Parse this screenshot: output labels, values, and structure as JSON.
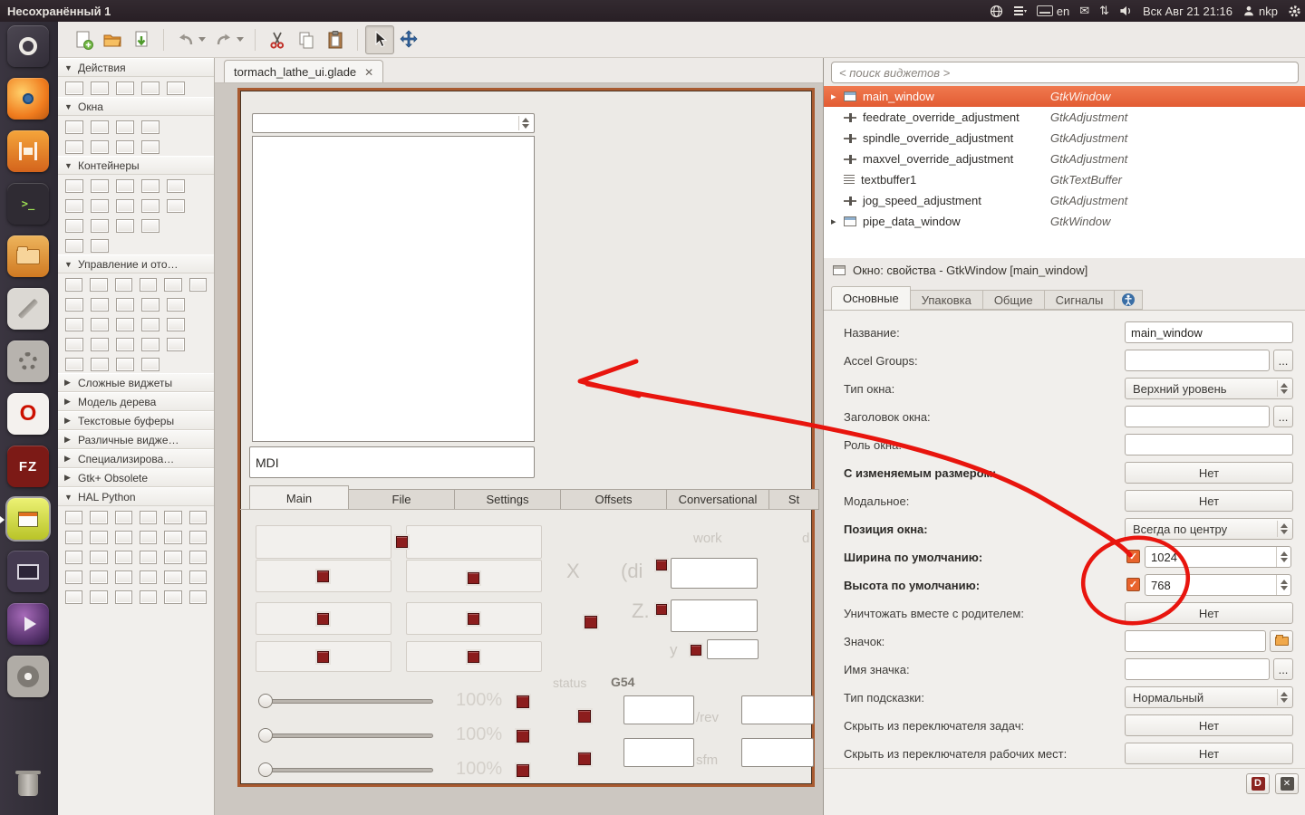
{
  "top_bar": {
    "title": "Несохранённый 1",
    "keyboard_layout": "en",
    "clock": "Вск Авг 21 21:16",
    "user": "nkp"
  },
  "dock": {
    "items": [
      "dash-home",
      "firefox",
      "software-center",
      "terminal",
      "file-manager",
      "text-editor",
      "system-settings",
      "opera",
      "filezilla",
      "glade",
      "remote-screen",
      "media-player",
      "disks",
      "trash"
    ]
  },
  "toolbar": {
    "icons": [
      "new-file",
      "open-file",
      "save-file",
      "undo",
      "undo-menu",
      "redo",
      "redo-menu",
      "cut",
      "copy",
      "paste",
      "selector",
      "drag-resize"
    ]
  },
  "palette": {
    "sections": [
      {
        "label": "Действия",
        "arrow": "▼",
        "rows": [
          5
        ]
      },
      {
        "label": "Окна",
        "arrow": "▼",
        "rows": [
          4,
          4
        ]
      },
      {
        "label": "Контейнеры",
        "arrow": "▼",
        "rows": [
          5,
          5,
          4,
          2
        ]
      },
      {
        "label": "Управление и ото…",
        "arrow": "▼",
        "rows": [
          6,
          5,
          5,
          5,
          4
        ]
      },
      {
        "label": "Сложные виджеты",
        "arrow": "▶",
        "rows": []
      },
      {
        "label": "Модель дерева",
        "arrow": "▶",
        "rows": []
      },
      {
        "label": "Текстовые буферы",
        "arrow": "▶",
        "rows": []
      },
      {
        "label": "Различные видже…",
        "arrow": "▶",
        "rows": []
      },
      {
        "label": "Специализирова…",
        "arrow": "▶",
        "rows": []
      },
      {
        "label": "Gtk+ Obsolete",
        "arrow": "▶",
        "rows": []
      },
      {
        "label": "HAL Python",
        "arrow": "▼",
        "rows": [
          6,
          6,
          6,
          6,
          6
        ]
      }
    ]
  },
  "editor": {
    "tab_label": "tormach_lathe_ui.glade"
  },
  "canvas": {
    "mdi_text": "MDI",
    "tabs": [
      "Main",
      "File",
      "Settings",
      "Offsets",
      "Conversational",
      "St"
    ],
    "labels": {
      "work": "work",
      "d": "d",
      "x": "X",
      "dia": "(di",
      "z": "Z.",
      "y": "y",
      "status": "status",
      "g54": "G54",
      "rev": "/rev",
      "sfm": "sfm"
    },
    "sliders": [
      "100%",
      "100%",
      "100%"
    ]
  },
  "tree": {
    "search_placeholder": "< поиск виджетов >",
    "rows": [
      {
        "name": "main_window",
        "cls": "GtkWindow"
      },
      {
        "name": "feedrate_override_adjustment",
        "cls": "GtkAdjustment"
      },
      {
        "name": "spindle_override_adjustment",
        "cls": "GtkAdjustment"
      },
      {
        "name": "maxvel_override_adjustment",
        "cls": "GtkAdjustment"
      },
      {
        "name": "textbuffer1",
        "cls": "GtkTextBuffer"
      },
      {
        "name": "jog_speed_adjustment",
        "cls": "GtkAdjustment"
      },
      {
        "name": "pipe_data_window",
        "cls": "GtkWindow"
      }
    ]
  },
  "properties": {
    "title": "Окно: свойства - GtkWindow [main_window]",
    "tabs": [
      "Основные",
      "Упаковка",
      "Общие",
      "Сигналы"
    ],
    "rows": [
      {
        "label": "Название:",
        "value": "main_window"
      },
      {
        "label": "Accel Groups:",
        "value": ""
      },
      {
        "label": "Тип окна:",
        "value": "Верхний уровень"
      },
      {
        "label": "Заголовок окна:",
        "value": ""
      },
      {
        "label": "Роль окна:",
        "value": ""
      },
      {
        "label": "С изменяемым размером:",
        "value": "Нет"
      },
      {
        "label": "Модальное:",
        "value": "Нет"
      },
      {
        "label": "Позиция окна:",
        "value": "Всегда по центру"
      },
      {
        "label": "Ширина по умолчанию:",
        "value": "1024"
      },
      {
        "label": "Высота по умолчанию:",
        "value": "768"
      },
      {
        "label": "Уничтожать вместе с родителем:",
        "value": "Нет"
      },
      {
        "label": "Значок:",
        "value": ""
      },
      {
        "label": "Имя значка:",
        "value": ""
      },
      {
        "label": "Тип подсказки:",
        "value": "Нормальный"
      },
      {
        "label": "Скрыть из переключателя задач:",
        "value": "Нет"
      },
      {
        "label": "Скрыть из переключателя рабочих мест:",
        "value": "Нет"
      }
    ]
  },
  "icons": {
    "check": "✓",
    "ellipsis": "...",
    "close": "✕",
    "tree_expander": "▸",
    "mail": "✉",
    "sync": "⇅",
    "terminal_glyph": ">_",
    "opera_glyph": "O",
    "filezilla_glyph": "FZ",
    "d_badge": "D",
    "clear_glyph": "✕"
  },
  "annotation": {
    "color": "#e8150e"
  }
}
